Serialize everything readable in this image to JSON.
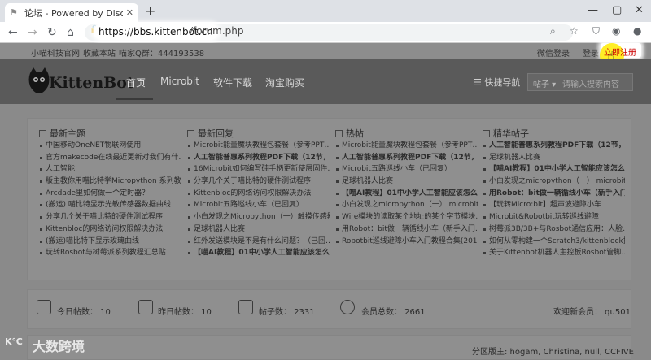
{
  "browser": {
    "tab_title": "论坛 - Powered by Discuz!",
    "url_host": "https://bbs.kittenbot.cn",
    "url_path": "/forum.php"
  },
  "topinfo": {
    "links": [
      "小喵科技官网",
      "收藏本站",
      "喵家Q群：444193538"
    ],
    "wechat_login": "微信登录",
    "login": "登录",
    "register": "立即注册"
  },
  "nav": {
    "logo_text": "KittenBot",
    "items": [
      "首页",
      "Microbit",
      "软件下载",
      "淘宝购买"
    ],
    "quick_nav": "快捷导航",
    "search_type": "帖子",
    "search_placeholder": "请输入搜索内容"
  },
  "columns": [
    {
      "title": "最新主题",
      "items": [
        "中国移动OneNET物联网使用",
        "官方makecode在线最近更新对我们有什…",
        "人工智能",
        "版主教你用喵比特学Micropython 系列教…",
        "Arcdade里如何做一个定时器？",
        "(搬运) 喵比特显示光敏传感器数据曲线",
        "分享几个关于喵比特的硬件测试程序",
        "Kittenbloc的网络访问权限解决办法",
        "(搬运)喵比特下显示玫瑰曲线",
        "玩转Rosbot与树莓派系列教程汇总贴"
      ],
      "bold": []
    },
    {
      "title": "最新回复",
      "items": [
        "Microbit能量魔块教程包套餐（参考PPT…",
        "人工智能普惠系列教程PDF下载（12节，…",
        "16Microbit如何编写硅手柄更新使层固件…",
        "分享几个关于喵比特的硬件测试程序",
        "Kittenbloc的网络访问权限解决办法",
        "Microbit五路巡线小车（已回复）",
        "小白发现之Micropython（一）触摸传感器",
        "足球机器人比赛",
        "红外发送模块是不是有什么问题？（已回…",
        "【喵AI教程】01中小学人工智能应该怎么…"
      ],
      "bold": [
        1,
        9
      ]
    },
    {
      "title": "热帖",
      "items": [
        "Microbit能量魔块教程包套餐（参考PPT…",
        "人工智能普惠系列教程PDF下载（12节，…",
        "Microbit五路巡线小车（已回复）",
        "足球机器人比赛",
        "【喵AI教程】01中小学人工智能应该怎么…",
        "小白发现之micropython（一） microbit …",
        "Wire模块的读取某个地址的某个字节模块…",
        "用Robot：bit做一辆循线小车（新手入门…",
        "Robotbit巡线避障小车入门教程合集(201…",
        ""
      ],
      "bold": [
        1,
        4
      ]
    },
    {
      "title": "精华帖子",
      "items": [
        "人工智能普惠系列教程PDF下载（12节，…",
        "足球机器人比赛",
        "【喵AI教程】01中小学人工智能应该怎么…",
        "小白发现之micropython（一） microbit …",
        "用Robot：bit做一辆循线小车（新手入门…",
        "【玩转Micro:bit】超声波避障小车",
        "Microbit&Robotbit玩转巡线避障",
        "树莓派3B/3B+与Rosbot通信应用：人脸…",
        "如何从零构建一个Scratch3/kittenblock插…",
        "关于Kittenbot机器人主控板Rosbot管脚…"
      ],
      "bold": [
        0,
        2,
        4
      ]
    }
  ],
  "stats": {
    "today": "今日帖数： 10",
    "yesterday": "昨日帖数： 10",
    "posts": "帖子数： 2331",
    "members": "会员总数： 2661",
    "welcome": "欢迎新会员： qu501"
  },
  "footer": {
    "partition": "分区版主: hogam, Christina, null, CCFIVE"
  },
  "watermark": "大数跨境",
  "colors": {
    "highlight": "#ffffff",
    "cursor": "#ffeb00",
    "register": "#cc0000"
  }
}
